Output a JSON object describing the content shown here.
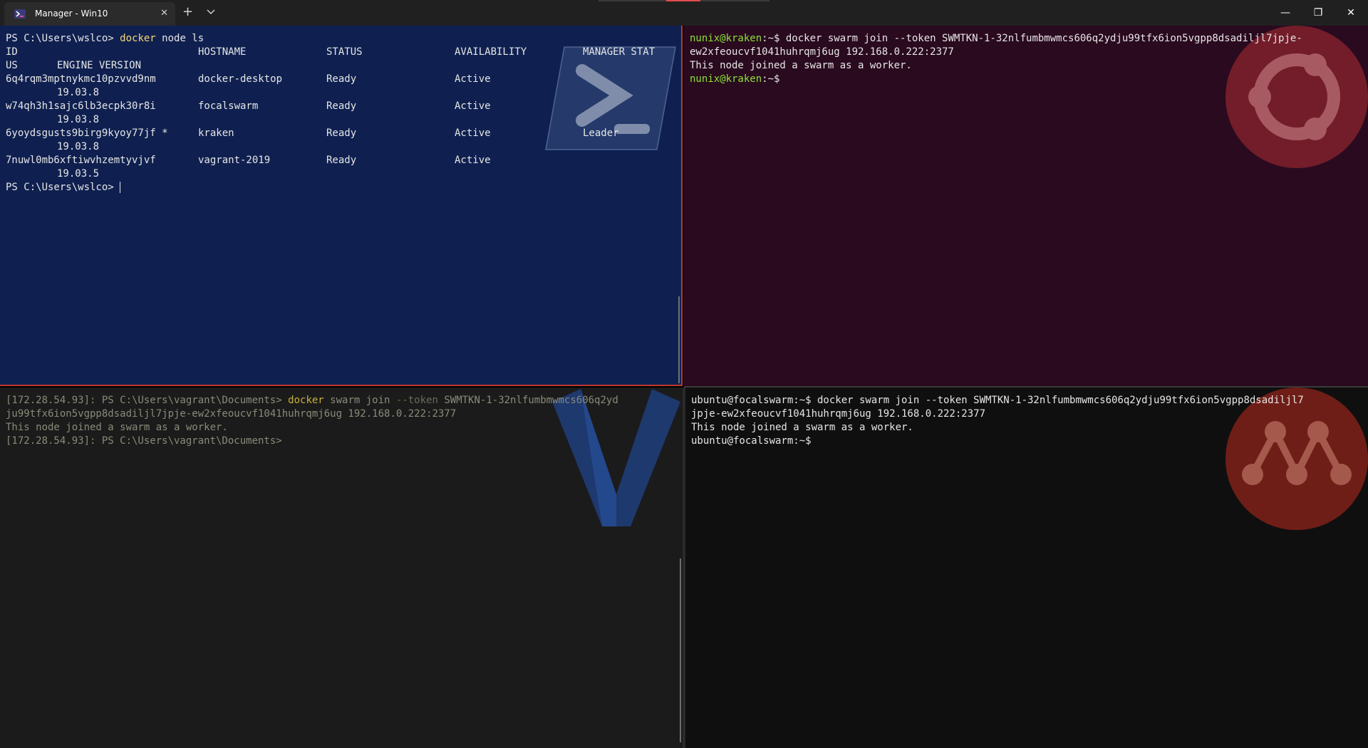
{
  "window": {
    "tab_title": "Manager - Win10",
    "tab_close_glyph": "✕",
    "new_tab_glyph": "+",
    "minimize_glyph": "—",
    "maximize_glyph": "❐",
    "close_glyph": "✕"
  },
  "colors": {
    "powershell_bg": "#0f2050",
    "ubuntu_bg": "#2a0a1f",
    "vagrant_bg": "#1b1b1b",
    "focal_bg": "#0f0f0f",
    "accent_red": "#c0392b"
  },
  "powershell": {
    "prompt": "PS C:\\Users\\wslco> ",
    "command_keyword": "docker",
    "command_rest": " node ls",
    "headers": {
      "id": "ID",
      "hostname": "HOSTNAME",
      "status": "STATUS",
      "availability": "AVAILABILITY",
      "manager_status": "MANAGER STAT",
      "us": "US",
      "engine_version": "ENGINE VERSION"
    },
    "nodes": [
      {
        "id": "6q4rqm3mptnykmc10pzvvd9nm",
        "hostname": "docker-desktop",
        "status": "Ready",
        "availability": "Active",
        "manager_status": "",
        "engine": "19.03.8"
      },
      {
        "id": "w74qh3h1sajc6lb3ecpk30r8i",
        "hostname": "focalswarm",
        "status": "Ready",
        "availability": "Active",
        "manager_status": "",
        "engine": "19.03.8"
      },
      {
        "id": "6yoydsgusts9birg9kyoy77jf *",
        "hostname": "kraken",
        "status": "Ready",
        "availability": "Active",
        "manager_status": "Leader",
        "engine": "19.03.8"
      },
      {
        "id": "7nuwl0mb6xftiwvhzemtyvjvf",
        "hostname": "vagrant-2019",
        "status": "Ready",
        "availability": "Active",
        "manager_status": "",
        "engine": "19.03.5"
      }
    ],
    "final_prompt": "PS C:\\Users\\wslco> "
  },
  "ubuntu": {
    "user_host": "nunix@kraken",
    "path": ":~$ ",
    "command_line1": "docker swarm join --token SWMTKN-1-32nlfumbmwmcs606q2ydju99tfx6ion5vgpp8dsadiljl7jpje-",
    "command_line2": "ew2xfeoucvf1041huhrqmj6ug 192.168.0.222:2377",
    "output": "This node joined a swarm as a worker.",
    "final_user_host": "nunix@kraken",
    "final_path": ":~$"
  },
  "vagrant": {
    "prompt": "[172.28.54.93]: PS C:\\Users\\vagrant\\Documents> ",
    "cmd_keyword": "docker",
    "cmd_swarm": " swarm join ",
    "cmd_flag": "--token",
    "cmd_token1": " SWMTKN-1-32nlfumbmwmcs606q2yd",
    "cmd_line2": "ju99tfx6ion5vgpp8dsadiljl7jpje-ew2xfeoucvf1041huhrqmj6ug 192.168.0.222:2377",
    "output": "This node joined a swarm as a worker.",
    "final_prompt": "[172.28.54.93]: PS C:\\Users\\vagrant\\Documents>"
  },
  "focal": {
    "line1": "ubuntu@focalswarm:~$ docker swarm join --token SWMTKN-1-32nlfumbmwmcs606q2ydju99tfx6ion5vgpp8dsadiljl7",
    "line2": "jpje-ew2xfeoucvf1041huhrqmj6ug 192.168.0.222:2377",
    "output": "This node joined a swarm as a worker.",
    "final_prompt": "ubuntu@focalswarm:~$"
  }
}
